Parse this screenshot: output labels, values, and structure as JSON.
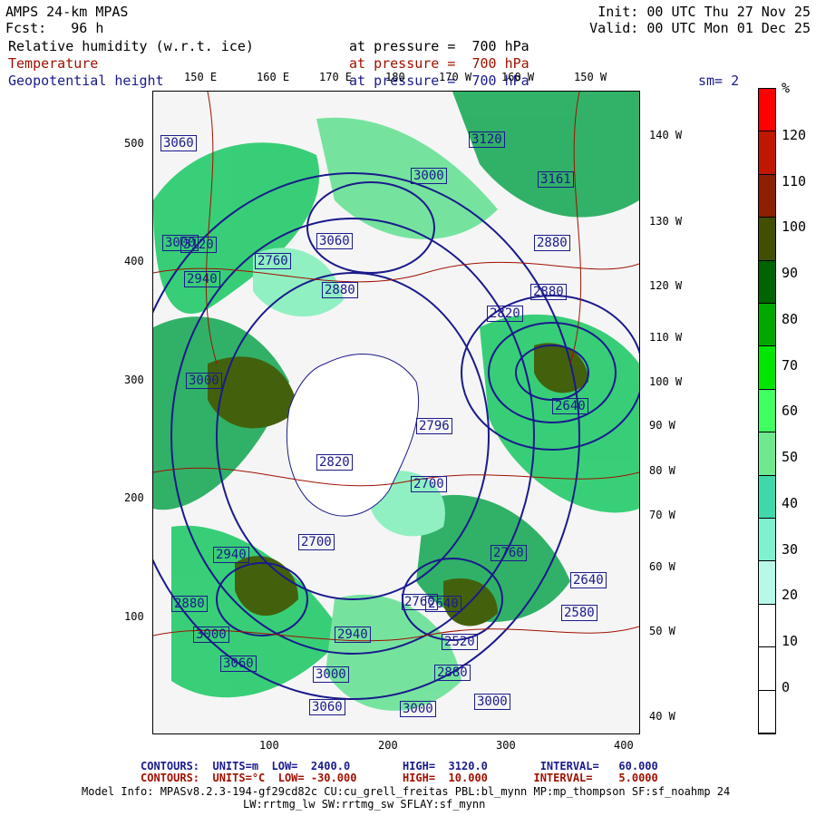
{
  "header": {
    "model_title": "AMPS 24-km MPAS",
    "fcst": "Fcst:   96 h",
    "init": "Init: 00 UTC Thu 27 Nov 25",
    "valid": "Valid: 00 UTC Mon 01 Dec 25",
    "field1_name": "Relative humidity (w.r.t. ice)",
    "field1_level": "at pressure =  700 hPa",
    "field2_name": "Temperature",
    "field2_level": "at pressure =  700 hPa",
    "field3_name": "Geopotential height",
    "field3_level": "at pressure =  700 hPa",
    "smoothing": "sm= 2"
  },
  "colors": {
    "temperature": "#a01000",
    "height": "#1a1a8c",
    "text": "#000000"
  },
  "longitude_top": [
    "150 E",
    "160 E",
    "170 E",
    "180",
    "170 W",
    "160 W",
    "150 W"
  ],
  "longitude_right": [
    "140 W",
    "130 W",
    "120 W",
    "110 W",
    "100 W",
    "90 W",
    "80 W",
    "70 W",
    "60 W",
    "50 W",
    "40 W"
  ],
  "y_ticks": [
    "500",
    "400",
    "300",
    "200",
    "100"
  ],
  "x_ticks": [
    "100",
    "200",
    "300",
    "400"
  ],
  "colorbar": {
    "unit": "%",
    "labels": [
      "120",
      "110",
      "100",
      "90",
      "80",
      "70",
      "60",
      "50",
      "40",
      "30",
      "20",
      "10",
      "0"
    ],
    "colors": [
      "#ff0000",
      "#c01800",
      "#8c2000",
      "#405000",
      "#006400",
      "#00a800",
      "#00e600",
      "#40ff60",
      "#70e890",
      "#40d8a8",
      "#7ff0d0",
      "#b8f8e8",
      "#ffffff",
      "#ffffff",
      "#ffffff"
    ]
  },
  "contour_labels": [
    "3060",
    "3120",
    "3000",
    "3161",
    "2880",
    "2760",
    "2940",
    "2880",
    "2820",
    "2640",
    "2796",
    "2700",
    "2820",
    "2700",
    "2760",
    "2640",
    "2580",
    "2880",
    "2940",
    "3000",
    "3060",
    "3000",
    "2940",
    "3000",
    "3000",
    "3060",
    "3120",
    "3060",
    "3000",
    "2880",
    "3000",
    "2760",
    "2640",
    "2520",
    "2880"
  ],
  "footer": {
    "height_contours": "CONTOURS:  UNITS=m  LOW=  2400.0        HIGH=  3120.0        INTERVAL=   60.000",
    "temp_contours": "CONTOURS:  UNITS=°C  LOW= -30.000       HIGH=  10.000       INTERVAL=    5.0000",
    "model_info": "Model Info: MPASv8.2.3-194-gf29cd82c CU:cu_grell_freitas PBL:bl_mynn MP:mp_thompson SF:sf_noahmp 24",
    "model_info2": "LW:rrtmg_lw SW:rrtmg_sw SFLAY:sf_mynn"
  }
}
